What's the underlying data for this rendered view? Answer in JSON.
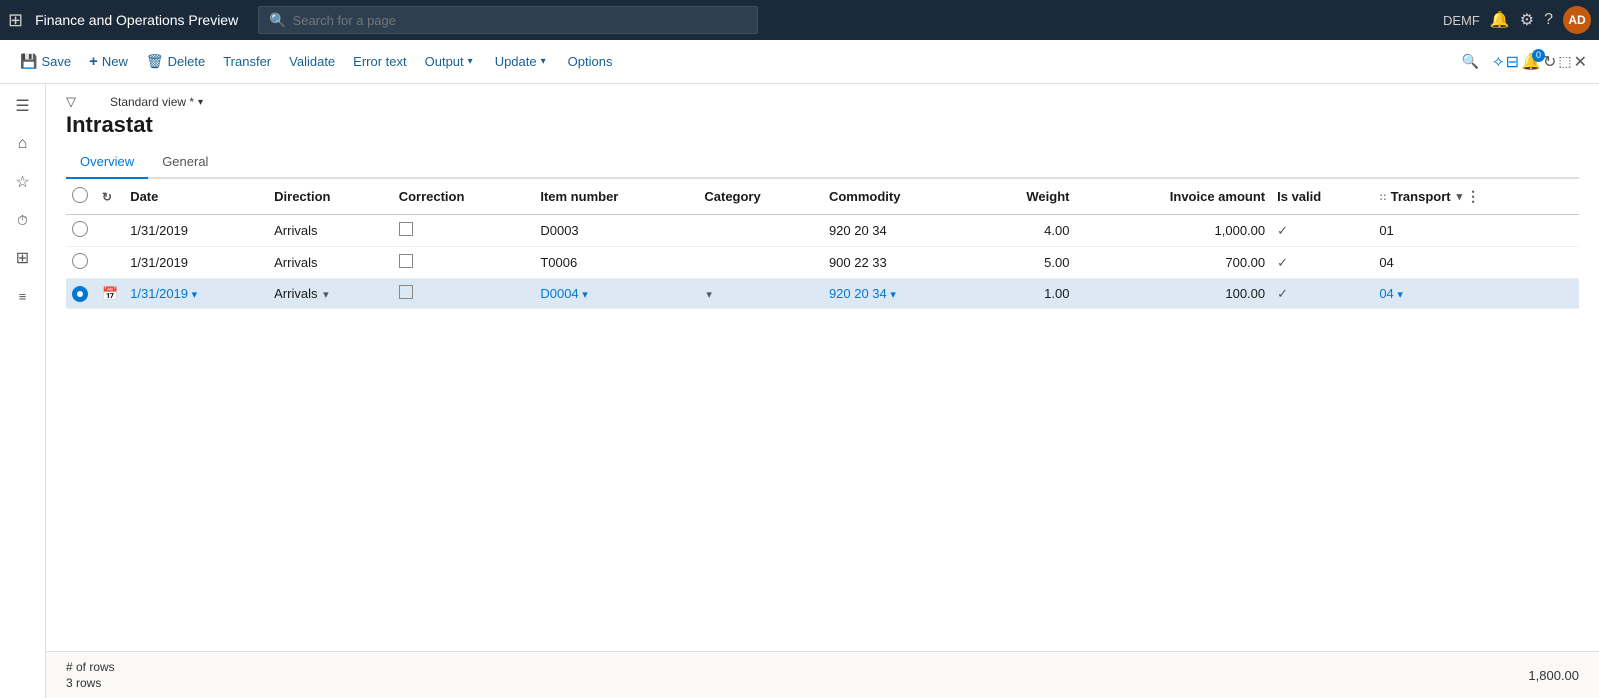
{
  "app": {
    "title": "Finance and Operations Preview",
    "search_placeholder": "Search for a page",
    "env_label": "DEMF"
  },
  "toolbar": {
    "save_label": "Save",
    "new_label": "New",
    "delete_label": "Delete",
    "transfer_label": "Transfer",
    "validate_label": "Validate",
    "error_text_label": "Error text",
    "output_label": "Output",
    "update_label": "Update",
    "options_label": "Options"
  },
  "page": {
    "view_label": "Standard view *",
    "title": "Intrastat"
  },
  "tabs": [
    {
      "label": "Overview",
      "active": true
    },
    {
      "label": "General",
      "active": false
    }
  ],
  "table": {
    "columns": [
      {
        "id": "select",
        "label": ""
      },
      {
        "id": "refresh",
        "label": ""
      },
      {
        "id": "date",
        "label": "Date"
      },
      {
        "id": "direction",
        "label": "Direction"
      },
      {
        "id": "correction",
        "label": "Correction"
      },
      {
        "id": "item_number",
        "label": "Item number"
      },
      {
        "id": "category",
        "label": "Category"
      },
      {
        "id": "commodity",
        "label": "Commodity"
      },
      {
        "id": "weight",
        "label": "Weight"
      },
      {
        "id": "invoice_amount",
        "label": "Invoice amount"
      },
      {
        "id": "is_valid",
        "label": "Is valid"
      },
      {
        "id": "transport",
        "label": "Transport"
      }
    ],
    "rows": [
      {
        "selected": false,
        "date": "1/31/2019",
        "direction": "Arrivals",
        "correction": false,
        "item_number": "D0003",
        "category": "",
        "commodity": "920 20 34",
        "weight": "4.00",
        "invoice_amount": "1,000.00",
        "is_valid": true,
        "transport": "01",
        "editing": false
      },
      {
        "selected": false,
        "date": "1/31/2019",
        "direction": "Arrivals",
        "correction": false,
        "item_number": "T0006",
        "category": "",
        "commodity": "900 22 33",
        "weight": "5.00",
        "invoice_amount": "700.00",
        "is_valid": true,
        "transport": "04",
        "editing": false
      },
      {
        "selected": true,
        "date": "1/31/2019",
        "direction": "Arrivals",
        "correction": false,
        "item_number": "D0004",
        "category": "",
        "commodity": "920 20 34",
        "weight": "1.00",
        "invoice_amount": "100.00",
        "is_valid": true,
        "transport": "04",
        "editing": true
      }
    ]
  },
  "footer": {
    "rows_label": "# of rows",
    "rows_count_label": "3 rows",
    "total_value": "1,800.00"
  },
  "sidebar": {
    "icons": [
      {
        "name": "hamburger-icon",
        "symbol": "☰"
      },
      {
        "name": "home-icon",
        "symbol": "⌂"
      },
      {
        "name": "star-icon",
        "symbol": "☆"
      },
      {
        "name": "clock-icon",
        "symbol": "⏱"
      },
      {
        "name": "grid-icon",
        "symbol": "⊞"
      },
      {
        "name": "list-icon",
        "symbol": "☰"
      }
    ]
  }
}
